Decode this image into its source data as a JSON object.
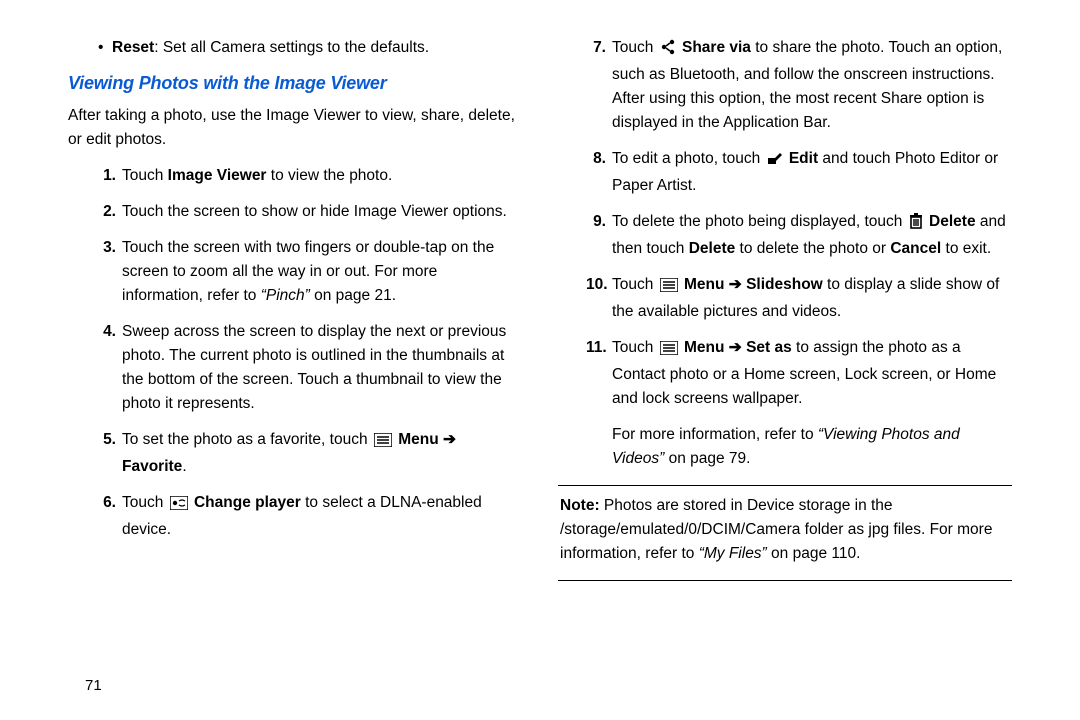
{
  "left": {
    "reset_label": "Reset",
    "reset_text": ": Set all Camera settings to the defaults.",
    "heading": "Viewing Photos with the Image Viewer",
    "intro": "After taking a photo, use the Image Viewer to view, share, delete, or edit photos.",
    "steps": {
      "s1_num": "1.",
      "s1_a": "Touch ",
      "s1_b": "Image Viewer",
      "s1_c": " to view the photo.",
      "s2_num": "2.",
      "s2": "Touch the screen to show or hide Image Viewer options.",
      "s3_num": "3.",
      "s3_a": "Touch the screen with two fingers or double-tap on the screen to zoom all the way in or out. For more information, refer to ",
      "s3_b": "“Pinch”",
      "s3_c": " on page 21.",
      "s4_num": "4.",
      "s4": "Sweep across the screen to display the next or previous photo. The current photo is outlined in the thumbnails at the bottom of the screen. Touch a thumbnail to view the photo it represents.",
      "s5_num": "5.",
      "s5_a": "To set the photo as a favorite, touch ",
      "s5_b": "Menu",
      "s5_arrow": " ➔ ",
      "s5_c": "Favorite",
      "s5_d": ".",
      "s6_num": "6.",
      "s6_a": "Touch ",
      "s6_b": "Change player",
      "s6_c": " to select a DLNA-enabled device."
    }
  },
  "right": {
    "steps": {
      "s7_num": "7.",
      "s7_a": "Touch ",
      "s7_b": "Share via",
      "s7_c": " to share the photo. Touch an option, such as Bluetooth, and follow the onscreen instructions. After using this option, the most recent Share option is displayed in the Application Bar.",
      "s8_num": "8.",
      "s8_a": "To edit a photo, touch ",
      "s8_b": "Edit",
      "s8_c": " and touch Photo Editor or Paper Artist.",
      "s9_num": "9.",
      "s9_a": "To delete the photo being displayed, touch ",
      "s9_b": "Delete",
      "s9_c": " and then touch ",
      "s9_d": "Delete",
      "s9_e": " to delete the photo or ",
      "s9_f": "Cancel",
      "s9_g": " to exit.",
      "s10_num": "10.",
      "s10_a": "Touch ",
      "s10_b": "Menu",
      "s10_arrow": " ➔ ",
      "s10_c": "Slideshow",
      "s10_d": " to display a slide show of the available pictures and videos.",
      "s11_num": "11.",
      "s11_a": "Touch ",
      "s11_b": "Menu",
      "s11_arrow": " ➔ ",
      "s11_c": "Set as",
      "s11_d": " to assign the photo as a Contact photo or a Home screen, Lock screen, or Home and lock screens wallpaper."
    },
    "more_a": "For more information, refer to ",
    "more_b": "“Viewing Photos and Videos”",
    "more_c": " on page 79.",
    "note_label": "Note:",
    "note_a": " Photos are stored in Device storage in the /storage/emulated/0/DCIM/Camera folder as jpg files. For more information, refer to ",
    "note_b": "“My Files”",
    "note_c": " on page 110."
  },
  "page_number": "71"
}
